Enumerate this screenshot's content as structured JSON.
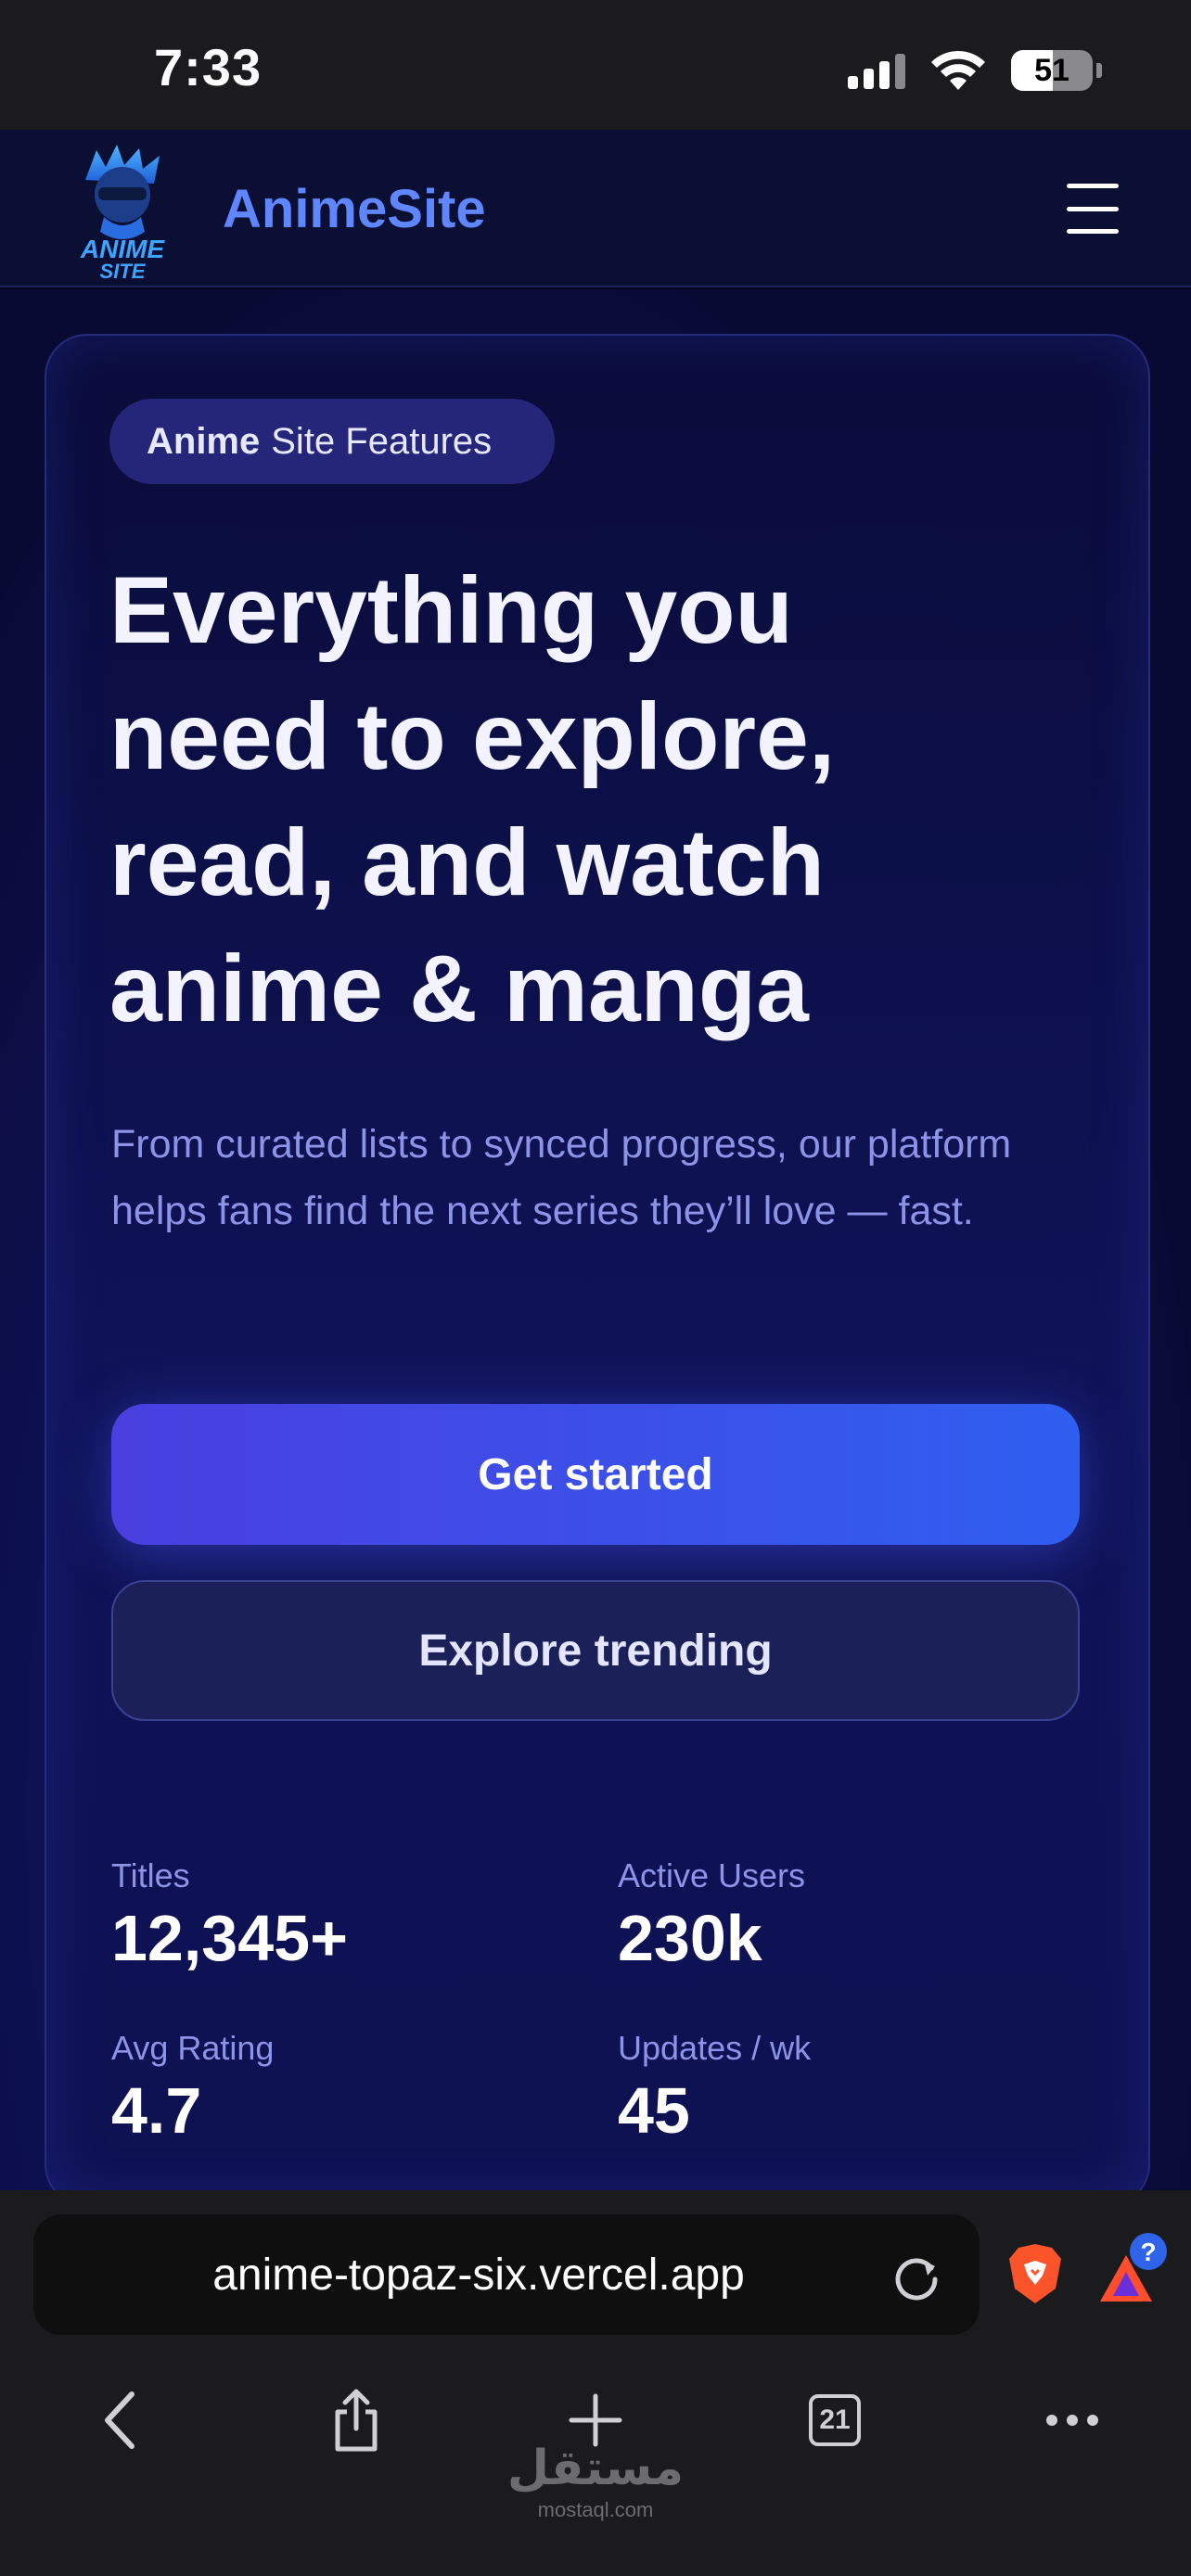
{
  "status_bar": {
    "time": "7:33",
    "battery": "51",
    "battery_level": 0.51
  },
  "header": {
    "brand": "AnimeSite",
    "logo_line1": "ANIME",
    "logo_line2": "SITE"
  },
  "hero": {
    "pill_bold": "Anime",
    "pill_rest": "Site Features",
    "headline": [
      "Everything you",
      "need to explore,",
      "read, and watch",
      "anime & manga"
    ],
    "subtext": "From curated lists to synced progress, our platform helps fans find the next series they’ll love — fast.",
    "primary_cta": "Get started",
    "secondary_cta": "Explore trending"
  },
  "stats": [
    {
      "label": "Titles",
      "value": "12,345+"
    },
    {
      "label": "Active Users",
      "value": "230k"
    },
    {
      "label": "Avg Rating",
      "value": "4.7"
    },
    {
      "label": "Updates / wk",
      "value": "45"
    }
  ],
  "browser": {
    "url": "anime-topaz-six.vercel.app",
    "tab_count": "21",
    "rewards_badge": "?"
  },
  "watermark": {
    "arabic": "مستقل",
    "latin": "mostaql.com"
  },
  "colors": {
    "brand": "#5f86ff",
    "cta_start": "#4a3fe0",
    "cta_end": "#2f5ff0",
    "muted": "#8d94e8"
  }
}
